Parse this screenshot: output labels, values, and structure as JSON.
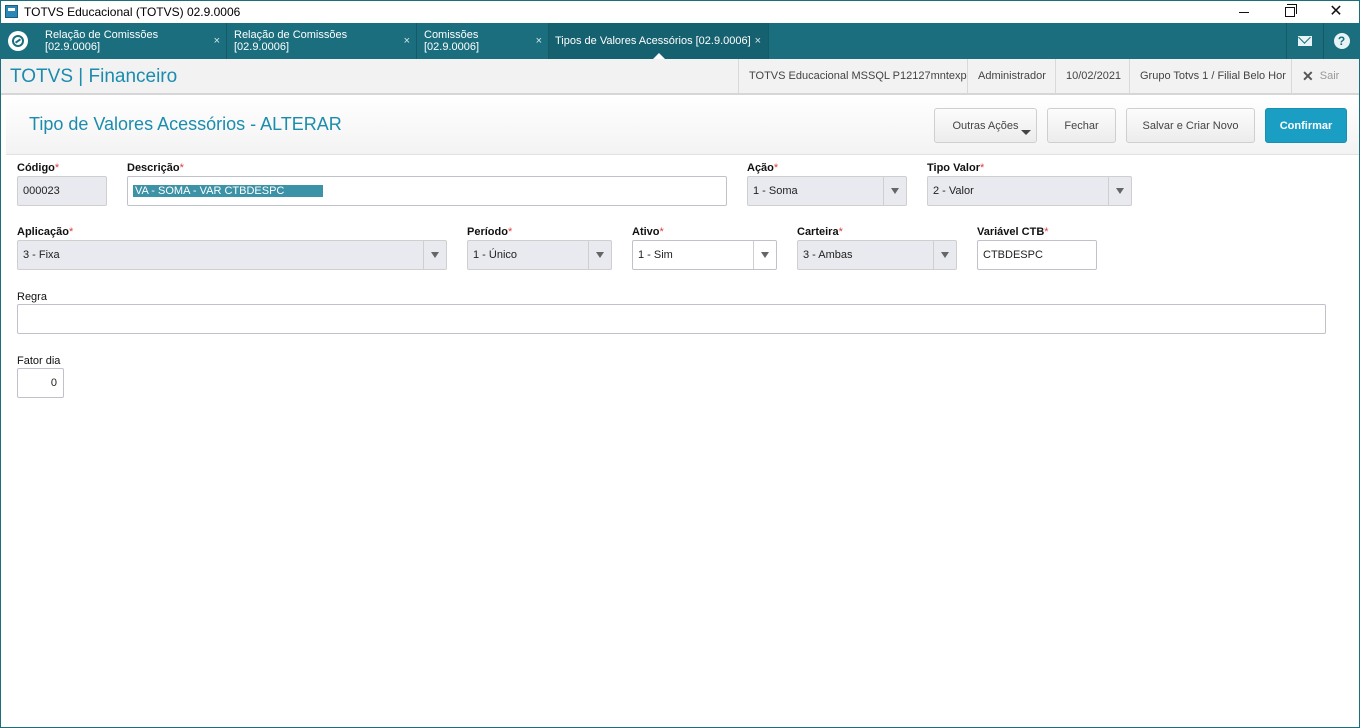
{
  "window": {
    "title": "TOTVS Educacional (TOTVS) 02.9.0006"
  },
  "tabs": [
    {
      "label": "Relação de Comissões [02.9.0006]"
    },
    {
      "label": "Relação de Comissões [02.9.0006]"
    },
    {
      "label": "Comissões [02.9.0006]"
    },
    {
      "label": "Tipos de Valores Acessórios [02.9.0006]"
    }
  ],
  "tab_close_glyph": "×",
  "header": {
    "brand": "TOTVS | Financeiro",
    "environment": "TOTVS Educacional MSSQL P12127mntexp",
    "user": "Administrador",
    "date": "10/02/2021",
    "branch": "Grupo Totvs 1 / Filial Belo Hor",
    "logout": "Sair"
  },
  "page": {
    "title": "Tipo de Valores Acessórios - ALTERAR",
    "buttons": {
      "other_actions": "Outras Ações",
      "close": "Fechar",
      "save_new": "Salvar e Criar Novo",
      "confirm": "Confirmar"
    }
  },
  "form": {
    "codigo": {
      "label": "Código",
      "value": "000023"
    },
    "descricao": {
      "label": "Descrição",
      "value": "VA - SOMA - VAR CTBDESPC"
    },
    "acao": {
      "label": "Ação",
      "value": "1 - Soma"
    },
    "tipo_valor": {
      "label": "Tipo Valor",
      "value": "2 - Valor"
    },
    "aplicacao": {
      "label": "Aplicação",
      "value": "3 - Fixa"
    },
    "periodo": {
      "label": "Período",
      "value": "1 - Único"
    },
    "ativo": {
      "label": "Ativo",
      "value": "1 - Sim"
    },
    "carteira": {
      "label": "Carteira",
      "value": "3 - Ambas"
    },
    "variavel_ctb": {
      "label": "Variável CTB",
      "value": "CTBDESPC"
    },
    "regra": {
      "label": "Regra",
      "value": ""
    },
    "fator_dia": {
      "label": "Fator dia",
      "value": "0"
    }
  },
  "required_marker": "*",
  "colors": {
    "accent": "#1b6e7e",
    "brand": "#1b8cae",
    "primary_button": "#1b9ec4",
    "required": "#e23b3b"
  }
}
